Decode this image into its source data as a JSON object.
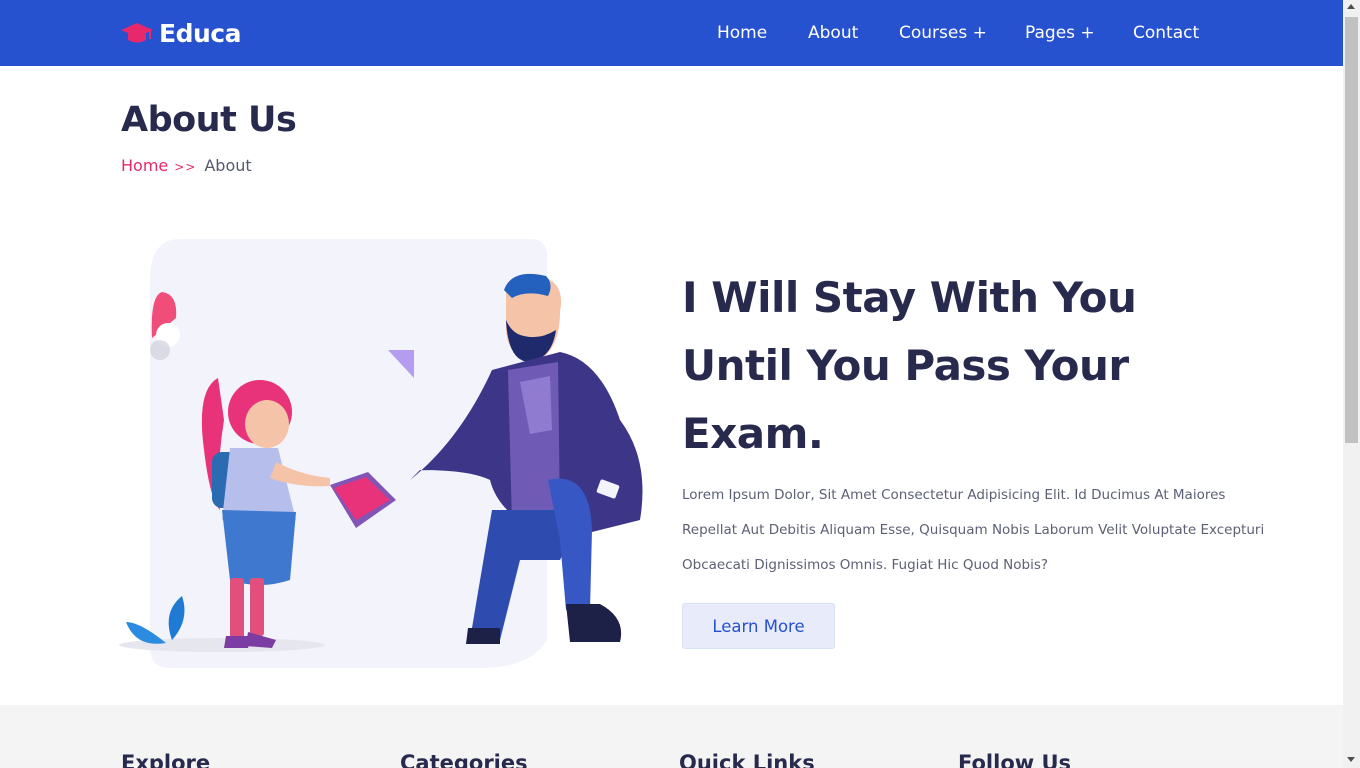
{
  "header": {
    "brand": "Educa",
    "brand_icon": "graduation-cap-icon",
    "nav": [
      "Home",
      "About",
      "Courses +",
      "Pages +",
      "Contact"
    ]
  },
  "page": {
    "title": "About Us",
    "breadcrumb": {
      "home": "Home",
      "separator": ">>",
      "current": "About"
    }
  },
  "about": {
    "headline": "I Will Stay With You Until You Pass Your Exam.",
    "body": "Lorem Ipsum Dolor, Sit Amet Consectetur Adipisicing Elit. Id Ducimus At Maiores Repellat Aut Debitis Aliquam Esse, Quisquam Nobis Laborum Velit Voluptate Excepturi Obcaecati Dignissimos Omnis. Fugiat Hic Quod Nobis?",
    "button": "Learn More"
  },
  "footer": {
    "headings": [
      "Explore",
      "Categories",
      "Quick Links",
      "Follow Us"
    ]
  },
  "colors": {
    "primary": "#2651cf",
    "accent": "#e8286a",
    "heading": "#272a4d",
    "footer_bg": "#f4f4f4"
  }
}
